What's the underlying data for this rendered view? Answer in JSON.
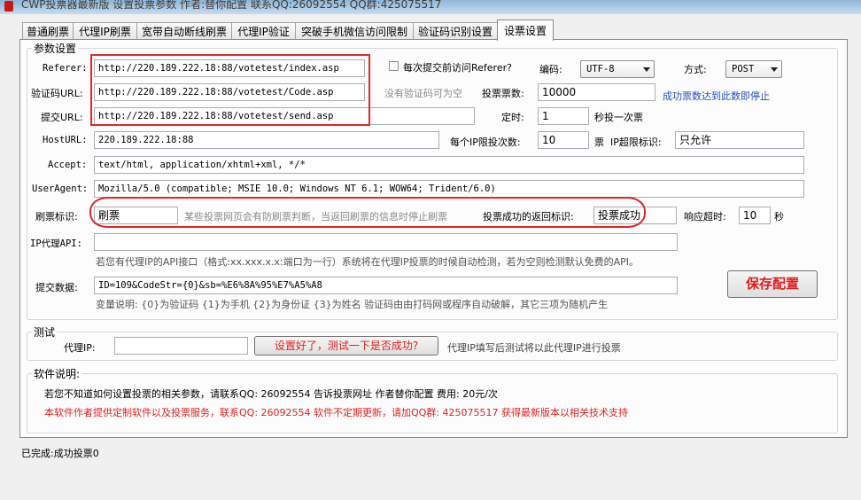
{
  "window": {
    "title": "CWP投票器最新版 设置投票参数 作者:替你配置 联系QQ:26092554 QQ群:425075517"
  },
  "tabs": [
    {
      "label": "普通刷票"
    },
    {
      "label": "代理IP刷票"
    },
    {
      "label": "宽带自动断线刷票"
    },
    {
      "label": "代理IP验证"
    },
    {
      "label": "突破手机微信访问限制"
    },
    {
      "label": "验证码识别设置"
    },
    {
      "label": "设票设置",
      "active": true
    }
  ],
  "params": {
    "legend": "参数设置",
    "referer": {
      "label": "Referer:",
      "value": "http://220.189.222.18:88/votetest/index.asp"
    },
    "captcha_url": {
      "label": "验证码URL:",
      "value": "http://220.189.222.18:88/votetest/Code.asp",
      "hint": "没有验证码可为空"
    },
    "submit_url": {
      "label": "提交URL:",
      "value": "http://220.189.222.18:88/votetest/send.asp"
    },
    "host_url": {
      "label": "HostURL:",
      "value": "220.189.222.18:88"
    },
    "accept": {
      "label": "Accept:",
      "value": "text/html, application/xhtml+xml, */*"
    },
    "user_agent": {
      "label": "UserAgent:",
      "value": "Mozilla/5.0 (compatible; MSIE 10.0; Windows NT 6.1; WOW64; Trident/6.0)"
    },
    "visit_referer": {
      "label": "每次提交前访问Referer?",
      "checked": false
    },
    "encoding": {
      "label": "编码:",
      "value": "UTF-8"
    },
    "method": {
      "label": "方式:",
      "value": "POST"
    },
    "vote_count": {
      "label": "投票票数:",
      "value": "10000",
      "note": "成功票数达到此数即停止"
    },
    "interval": {
      "label": "定时:",
      "value": "1",
      "unit": "秒投一次票"
    },
    "per_ip": {
      "label": "每个IP限投次数:",
      "value": "10",
      "unit": "票",
      "ip_limit_label": "IP超限标识:",
      "ip_limit_value": "只允许"
    },
    "brush_flag": {
      "label": "刷票标识:",
      "value": "刷票",
      "hint": "某些投票网页会有防刷票判断，当返回刷票的信息时停止刷票"
    },
    "success_flag": {
      "label": "投票成功的返回标识:",
      "value": "投票成功"
    },
    "timeout": {
      "label": "响应超时:",
      "value": "10",
      "unit": "秒"
    },
    "proxy_api": {
      "label": "IP代理API:",
      "value": "",
      "hint": "若您有代理IP的API接口（格式:xx.xxx.x.x:端口为一行）系统将在代理IP投票的时候自动检测，若为空则检测默认免费的API。"
    },
    "post_data": {
      "label": "提交数据:",
      "value": "ID=109&CodeStr={0}&sb=%E6%8A%95%E7%A5%A8",
      "hint": "变量说明: {0}为验证码 {1}为手机 {2}为身份证 {3}为姓名 验证码由由打码网或程序自动破解，其它三项为随机产生"
    },
    "save_label": "保存配置"
  },
  "test": {
    "legend": "测试",
    "proxy_label": "代理IP:",
    "proxy_value": "",
    "button_label": "设置好了，测试一下是否成功?",
    "note": "代理IP填写后测试将以此代理IP进行投票"
  },
  "about": {
    "legend": "软件说明:",
    "line1": "若您不知道如何设置投票的相关参数，请联系QQ: 26092554 告诉投票网址 作者替你配置 费用: 20元/次",
    "line2": "本软件作者提供定制软件以及投票服务，联系QQ: 26092554 软件不定期更新，请加QQ群: 425075517 获得最新版本以相关技术支持"
  },
  "status": {
    "text": "已完成:成功投票0"
  },
  "colors": {
    "highlight_red": "#e02020",
    "link_blue": "#2050c8",
    "save_text": "#e02020"
  }
}
